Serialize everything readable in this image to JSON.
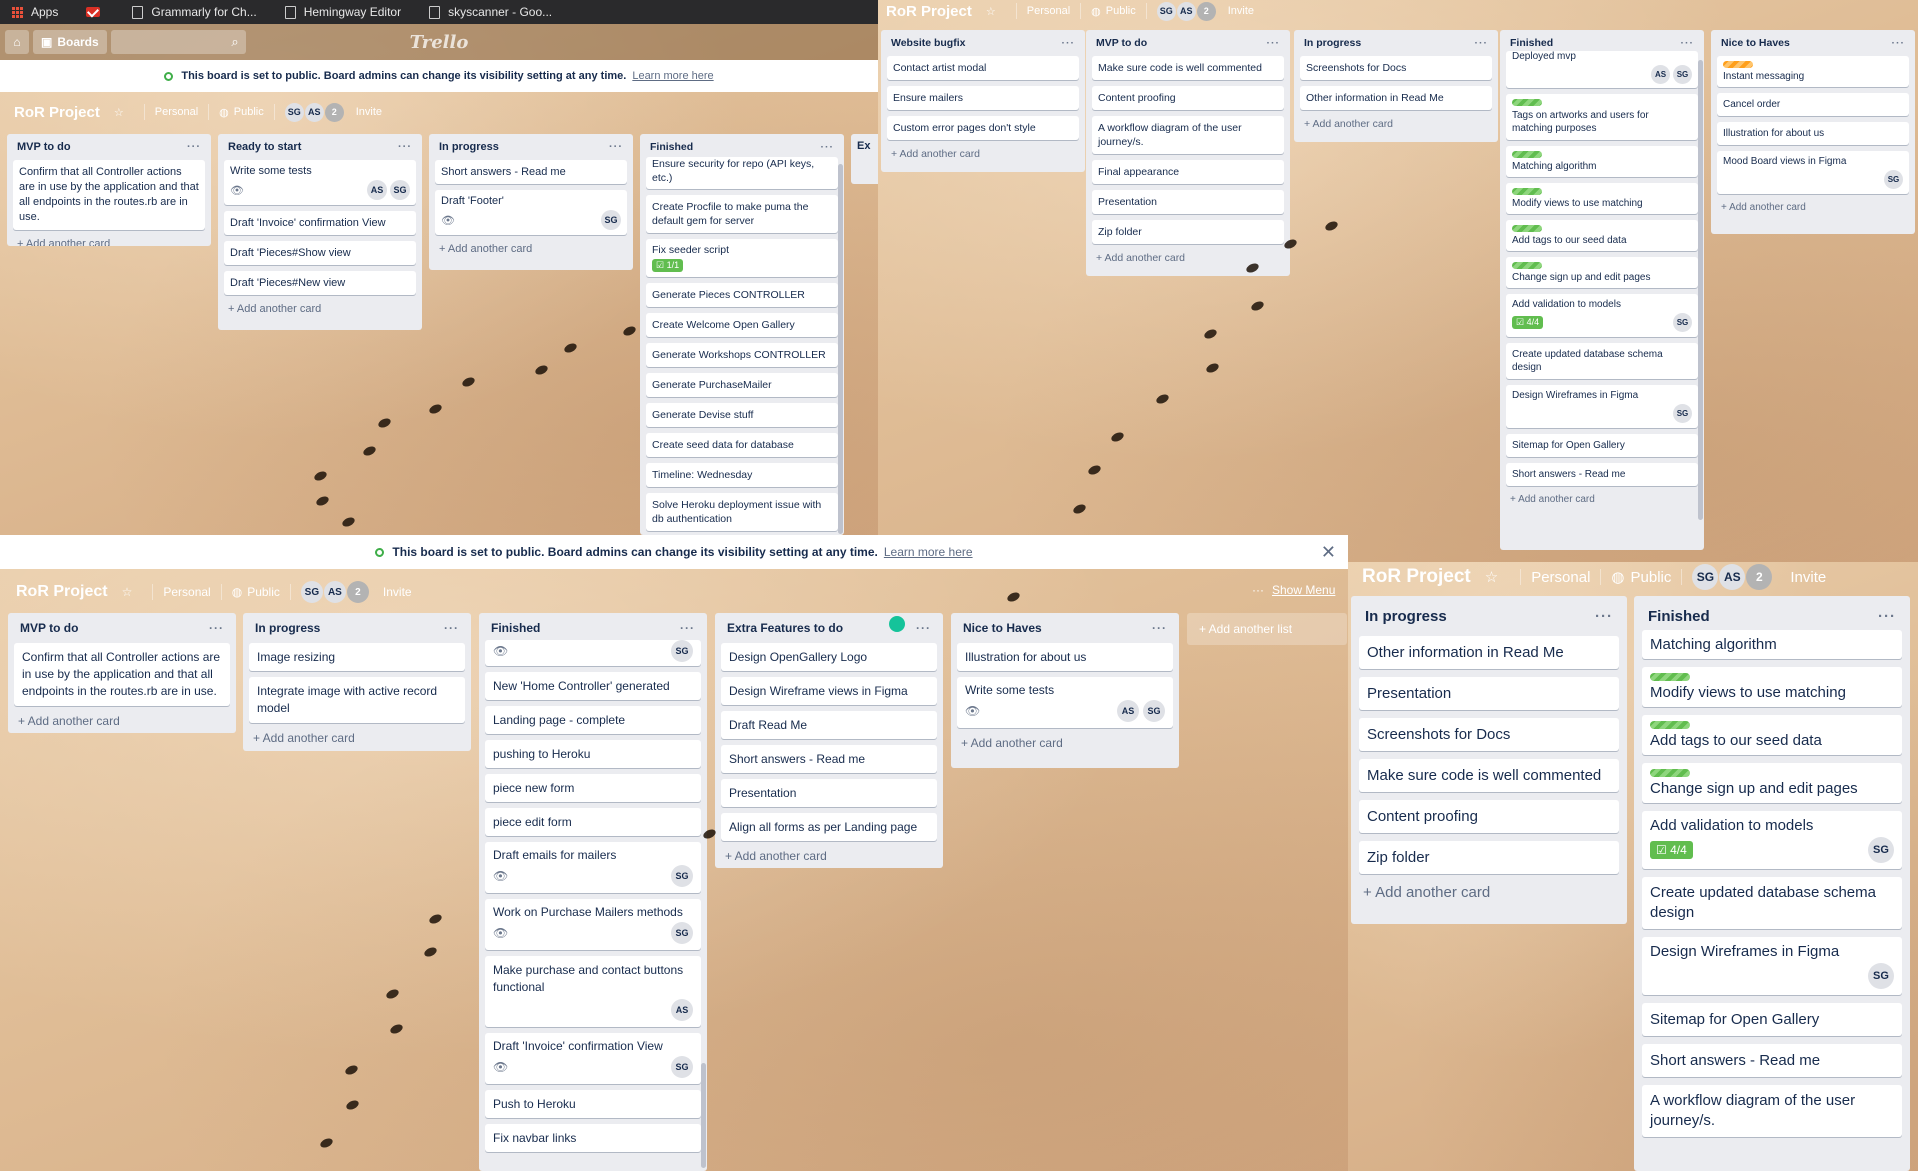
{
  "browser": {
    "bookmarks": [
      "Apps",
      "Grammarly for Ch...",
      "Hemingway Editor",
      "skyscanner - Goo..."
    ],
    "boards_label": "Boards",
    "logo": "Trello"
  },
  "notice": {
    "text": "This board is set to public. Board admins can change its visibility setting at any time.",
    "link": "Learn more here"
  },
  "board": {
    "title": "RoR Project",
    "personal": "Personal",
    "public": "Public",
    "members": [
      "SG",
      "AS"
    ],
    "member_count": "2",
    "invite": "Invite",
    "show_menu": "Show Menu",
    "add_list": "+ Add another list"
  },
  "add_card": "+ Add another card",
  "tl": {
    "mvp": {
      "title": "MVP to do",
      "cards": [
        "Confirm that all Controller actions are in use by the application and that all endpoints in the routes.rb are in use."
      ]
    },
    "ready": {
      "title": "Ready to start",
      "c1": "Write some tests",
      "c1m": [
        "AS",
        "SG"
      ],
      "cards": [
        "Draft 'Invoice' confirmation View",
        "Draft 'Pieces#Show view",
        "Draft 'Pieces#New view"
      ]
    },
    "prog": {
      "title": "In progress",
      "c1": "Short answers - Read me",
      "c2": "Draft 'Footer'",
      "c2m": "SG"
    },
    "fin": {
      "title": "Finished",
      "c0": "Ensure security for repo (API keys, etc.)",
      "c1": "Create Procfile to make puma the default gem for server",
      "c2": "Fix seeder script",
      "c2chk": "1/1",
      "cards": [
        "Generate Pieces CONTROLLER",
        "Create Welcome Open Gallery",
        "Generate Workshops CONTROLLER",
        "Generate PurchaseMailer",
        "Generate Devise stuff",
        "Create seed data for database",
        "Timeline: Wednesday"
      ],
      "clast": "Solve Heroku deployment issue with db authentication"
    },
    "ext": "Ex"
  },
  "tr": {
    "bug": {
      "title": "Website bugfix",
      "cards": [
        "Contact artist modal",
        "Ensure mailers",
        "Custom error pages don't style"
      ]
    },
    "mvp": {
      "title": "MVP to do",
      "cards": [
        "Make sure code is well commented",
        "Content proofing",
        "A workflow diagram of the user journey/s.",
        "Final appearance",
        "Presentation",
        "Zip folder"
      ]
    },
    "prog": {
      "title": "In progress",
      "cards": [
        "Screenshots for Docs",
        "Other information in Read Me"
      ]
    },
    "fin": {
      "title": "Finished",
      "c0": "Deployed mvp",
      "c0m": [
        "AS",
        "SG"
      ],
      "lab": [
        "Tags on artworks and users for matching purposes",
        "Matching algorithm",
        "Modify views to use matching",
        "Add tags to our seed data",
        "Change sign up and edit pages"
      ],
      "c6": "Add validation to models",
      "c6chk": "4/4",
      "c6m": "SG",
      "c7": "Create updated database schema design",
      "c8": "Design Wireframes in Figma",
      "c8m": "SG",
      "cards": [
        "Sitemap for Open Gallery",
        "Short answers - Read me"
      ]
    },
    "nice": {
      "title": "Nice to Haves",
      "c1": "Instant messaging",
      "cards": [
        "Cancel order",
        "Illustration for about us"
      ],
      "c4": "Mood Board views in Figma",
      "c4m": "SG"
    }
  },
  "bl": {
    "mvp": {
      "title": "MVP to do",
      "cards": [
        "Confirm that all Controller actions are in use by the application and that all endpoints in the routes.rb are in use."
      ]
    },
    "prog": {
      "title": "In progress",
      "cards": [
        "Image resizing",
        "Integrate image with active record model"
      ]
    },
    "fin": {
      "title": "Finished",
      "c0m": "SG",
      "cards": [
        "New 'Home Controller' generated",
        "Landing page - complete",
        "pushing to Heroku",
        "piece new form",
        "piece edit form"
      ],
      "c6": "Draft emails for mailers",
      "c6m": "SG",
      "c7": "Work on Purchase Mailers methods",
      "c7m": "SG",
      "c8": "Make purchase and contact buttons functional",
      "c8m": "AS",
      "c9": "Draft 'Invoice' confirmation View",
      "c9m": "SG",
      "tail": [
        "Push to Heroku",
        "Fix navbar links"
      ]
    },
    "extra": {
      "title": "Extra Features to do",
      "cards": [
        "Design OpenGallery Logo",
        "Design Wireframe views in Figma",
        "Draft Read Me",
        "Short answers - Read me",
        "Presentation",
        "Align all forms as per Landing page"
      ]
    },
    "nice": {
      "title": "Nice to Haves",
      "c1": "Illustration for about us",
      "c2": "Write some tests",
      "c2m": [
        "AS",
        "SG"
      ]
    }
  },
  "br": {
    "prog": {
      "title": "In progress",
      "cards": [
        "Other information in Read Me",
        "Presentation",
        "Screenshots for Docs",
        "Make sure code is well commented",
        "Content proofing",
        "Zip folder"
      ]
    },
    "fin": {
      "title": "Finished",
      "c0": "Matching algorithm",
      "lab": [
        "Modify views to use matching",
        "Add tags to our seed data",
        "Change sign up and edit pages"
      ],
      "c4": "Add validation to models",
      "c4chk": "4/4",
      "c4m": "SG",
      "c5": "Create updated database schema design",
      "c6": "Design Wireframes in Figma",
      "c6m": "SG",
      "cards": [
        "Sitemap for Open Gallery",
        "Short answers - Read me",
        "A workflow diagram of the user journey/s."
      ]
    }
  }
}
